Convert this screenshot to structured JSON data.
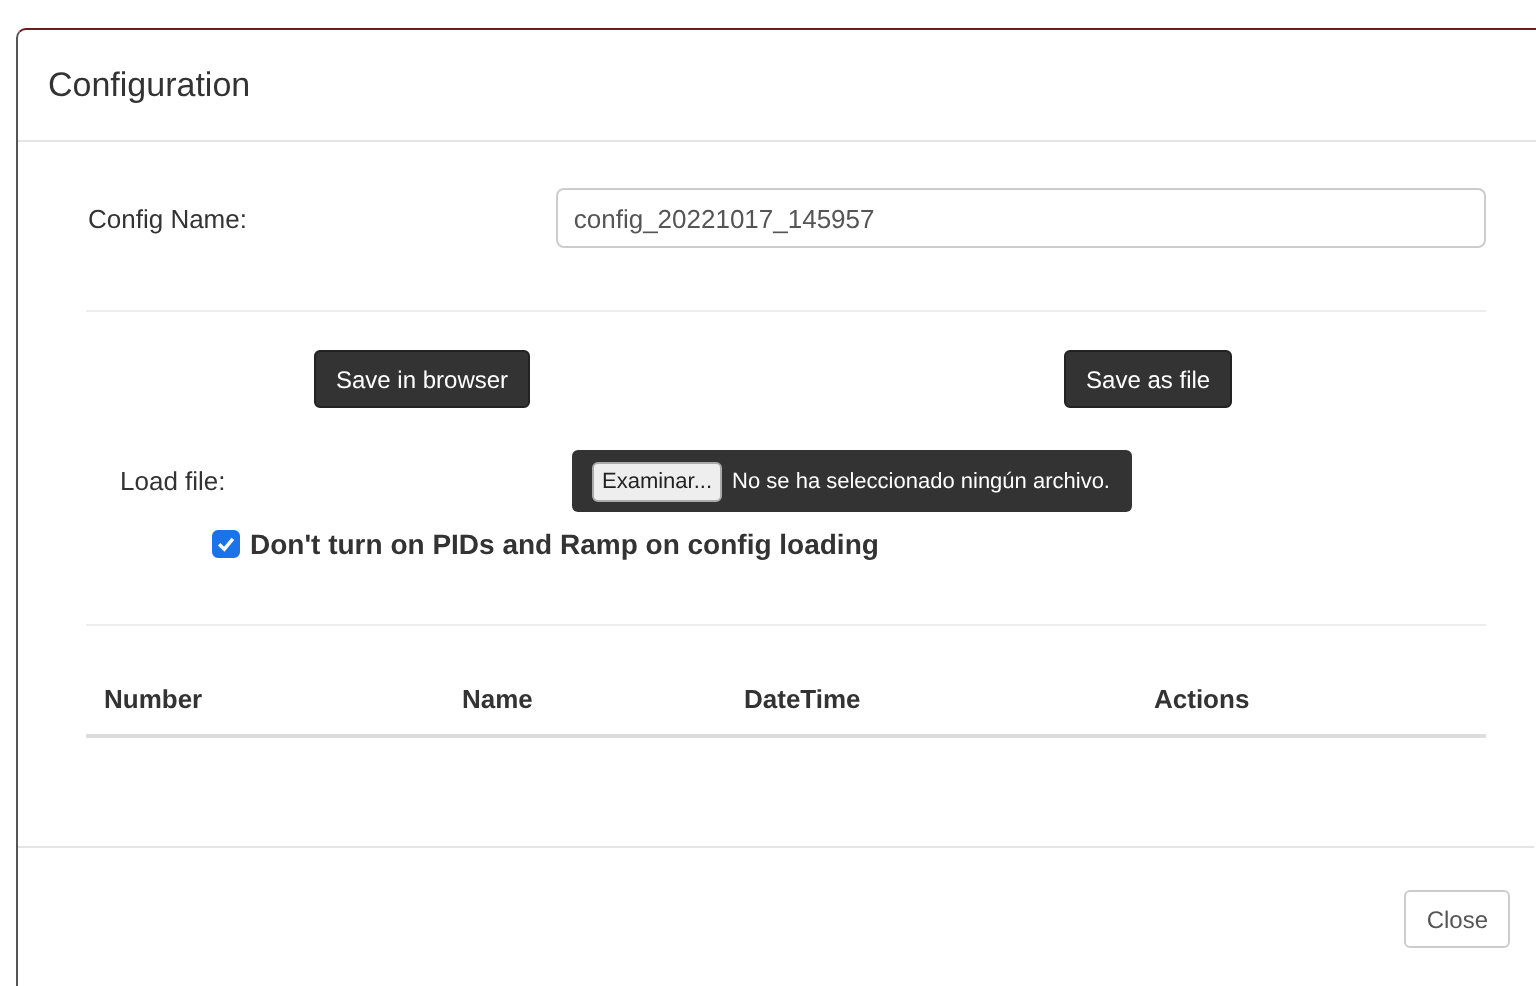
{
  "window": {
    "title": "Configuration"
  },
  "config_name": {
    "label": "Config Name:",
    "value": "config_20221017_145957"
  },
  "buttons": [
    {
      "label": "Save in browser"
    },
    {
      "label": "Save as file"
    }
  ],
  "load_file": {
    "label": "Load file:",
    "browse_button": "Examinar...",
    "status": "No se ha seleccionado ningún archivo."
  },
  "option": {
    "label": "Don't turn on PIDs and Ramp on config loading",
    "checked": true
  },
  "table": {
    "columns": [
      "Number",
      "Name",
      "DateTime",
      "Actions"
    ]
  },
  "footer": {
    "close_button": "Close"
  }
}
